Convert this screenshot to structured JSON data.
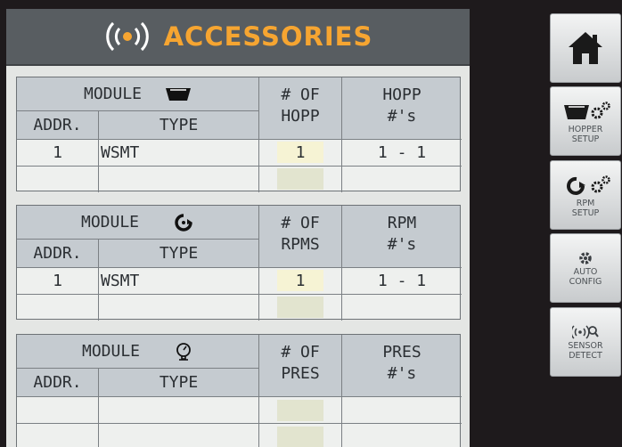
{
  "header": {
    "title": "ACCESSORIES",
    "icon": "broadcast-icon"
  },
  "colors": {
    "title": "#f6a531",
    "header_bg": "#585d61",
    "value_bg": "#f6f3d4"
  },
  "hopper_table": {
    "module_label": "MODULE",
    "icon": "hopper-icon",
    "addr_label": "ADDR.",
    "type_label": "TYPE",
    "count_label_1": "# OF",
    "count_label_2": "HOPP",
    "range_label_1": "HOPP",
    "range_label_2": "#'s",
    "rows": [
      {
        "addr": "1",
        "type": "WSMT",
        "count": "1",
        "range": "1 - 1"
      }
    ]
  },
  "rpm_table": {
    "module_label": "MODULE",
    "icon": "rpm-sensor-icon",
    "addr_label": "ADDR.",
    "type_label": "TYPE",
    "count_label_1": "# OF",
    "count_label_2": "RPMS",
    "range_label_1": "RPM",
    "range_label_2": "#'s",
    "rows": [
      {
        "addr": "1",
        "type": "WSMT",
        "count": "1",
        "range": "1 - 1"
      }
    ]
  },
  "pres_table": {
    "module_label": "MODULE",
    "icon": "pressure-gauge-icon",
    "addr_label": "ADDR.",
    "type_label": "TYPE",
    "count_label_1": "# OF",
    "count_label_2": "PRES",
    "range_label_1": "PRES",
    "range_label_2": "#'s"
  },
  "sidebar": {
    "home": {
      "icon": "home-icon"
    },
    "hopper_setup": {
      "label_1": "HOPPER",
      "label_2": "SETUP",
      "icon": "hopper-gear-icon"
    },
    "rpm_setup": {
      "label_1": "RPM",
      "label_2": "SETUP",
      "icon": "rpm-gear-icon"
    },
    "auto_config": {
      "label_1": "AUTO",
      "label_2": "CONFIG",
      "icon": "gear-icon"
    },
    "sensor_detect": {
      "label_1": "SENSOR",
      "label_2": "DETECT",
      "icon": "sensor-search-icon"
    }
  }
}
